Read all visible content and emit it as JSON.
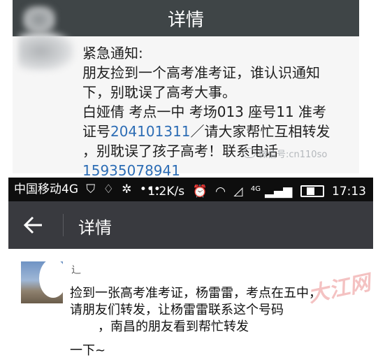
{
  "top": {
    "title": "详情",
    "message_lines": [
      "紧急通知:",
      "朋友捡到一个高考准考证，谁认识通知",
      "下，别耽误了高考大事。",
      "白娅倩 考点一中 考场013 座号11 准考",
      "，别耽误了孩子高考！联系电话"
    ],
    "exam_id_prefix": "证号",
    "exam_id": "204101311",
    "exam_id_suffix": "／请大家帮忙互相转发",
    "phone": "15935078941",
    "watermark": "微信号:cn110so"
  },
  "status_bar": {
    "carrier": "中国移动4G",
    "speed": "1.2K/s",
    "network": "4G",
    "time": "17:13",
    "battery_level": 0.45
  },
  "bottom": {
    "nav_title": "详情",
    "sender": "辶",
    "message_lines": [
      "捡到一张高考准考证，杨雷雷，考点在五中，",
      "请朋友们转发，让杨雷雷联系这个号码",
      "，南昌的朋友看到帮忙转发"
    ],
    "continuation": "一下~",
    "watermark": "大江网"
  },
  "colors": {
    "title_bar": "#3f4547",
    "nav_bar": "#393a3f",
    "status_bar": "#0e0e0e",
    "link_blue": "#2d6db5"
  }
}
